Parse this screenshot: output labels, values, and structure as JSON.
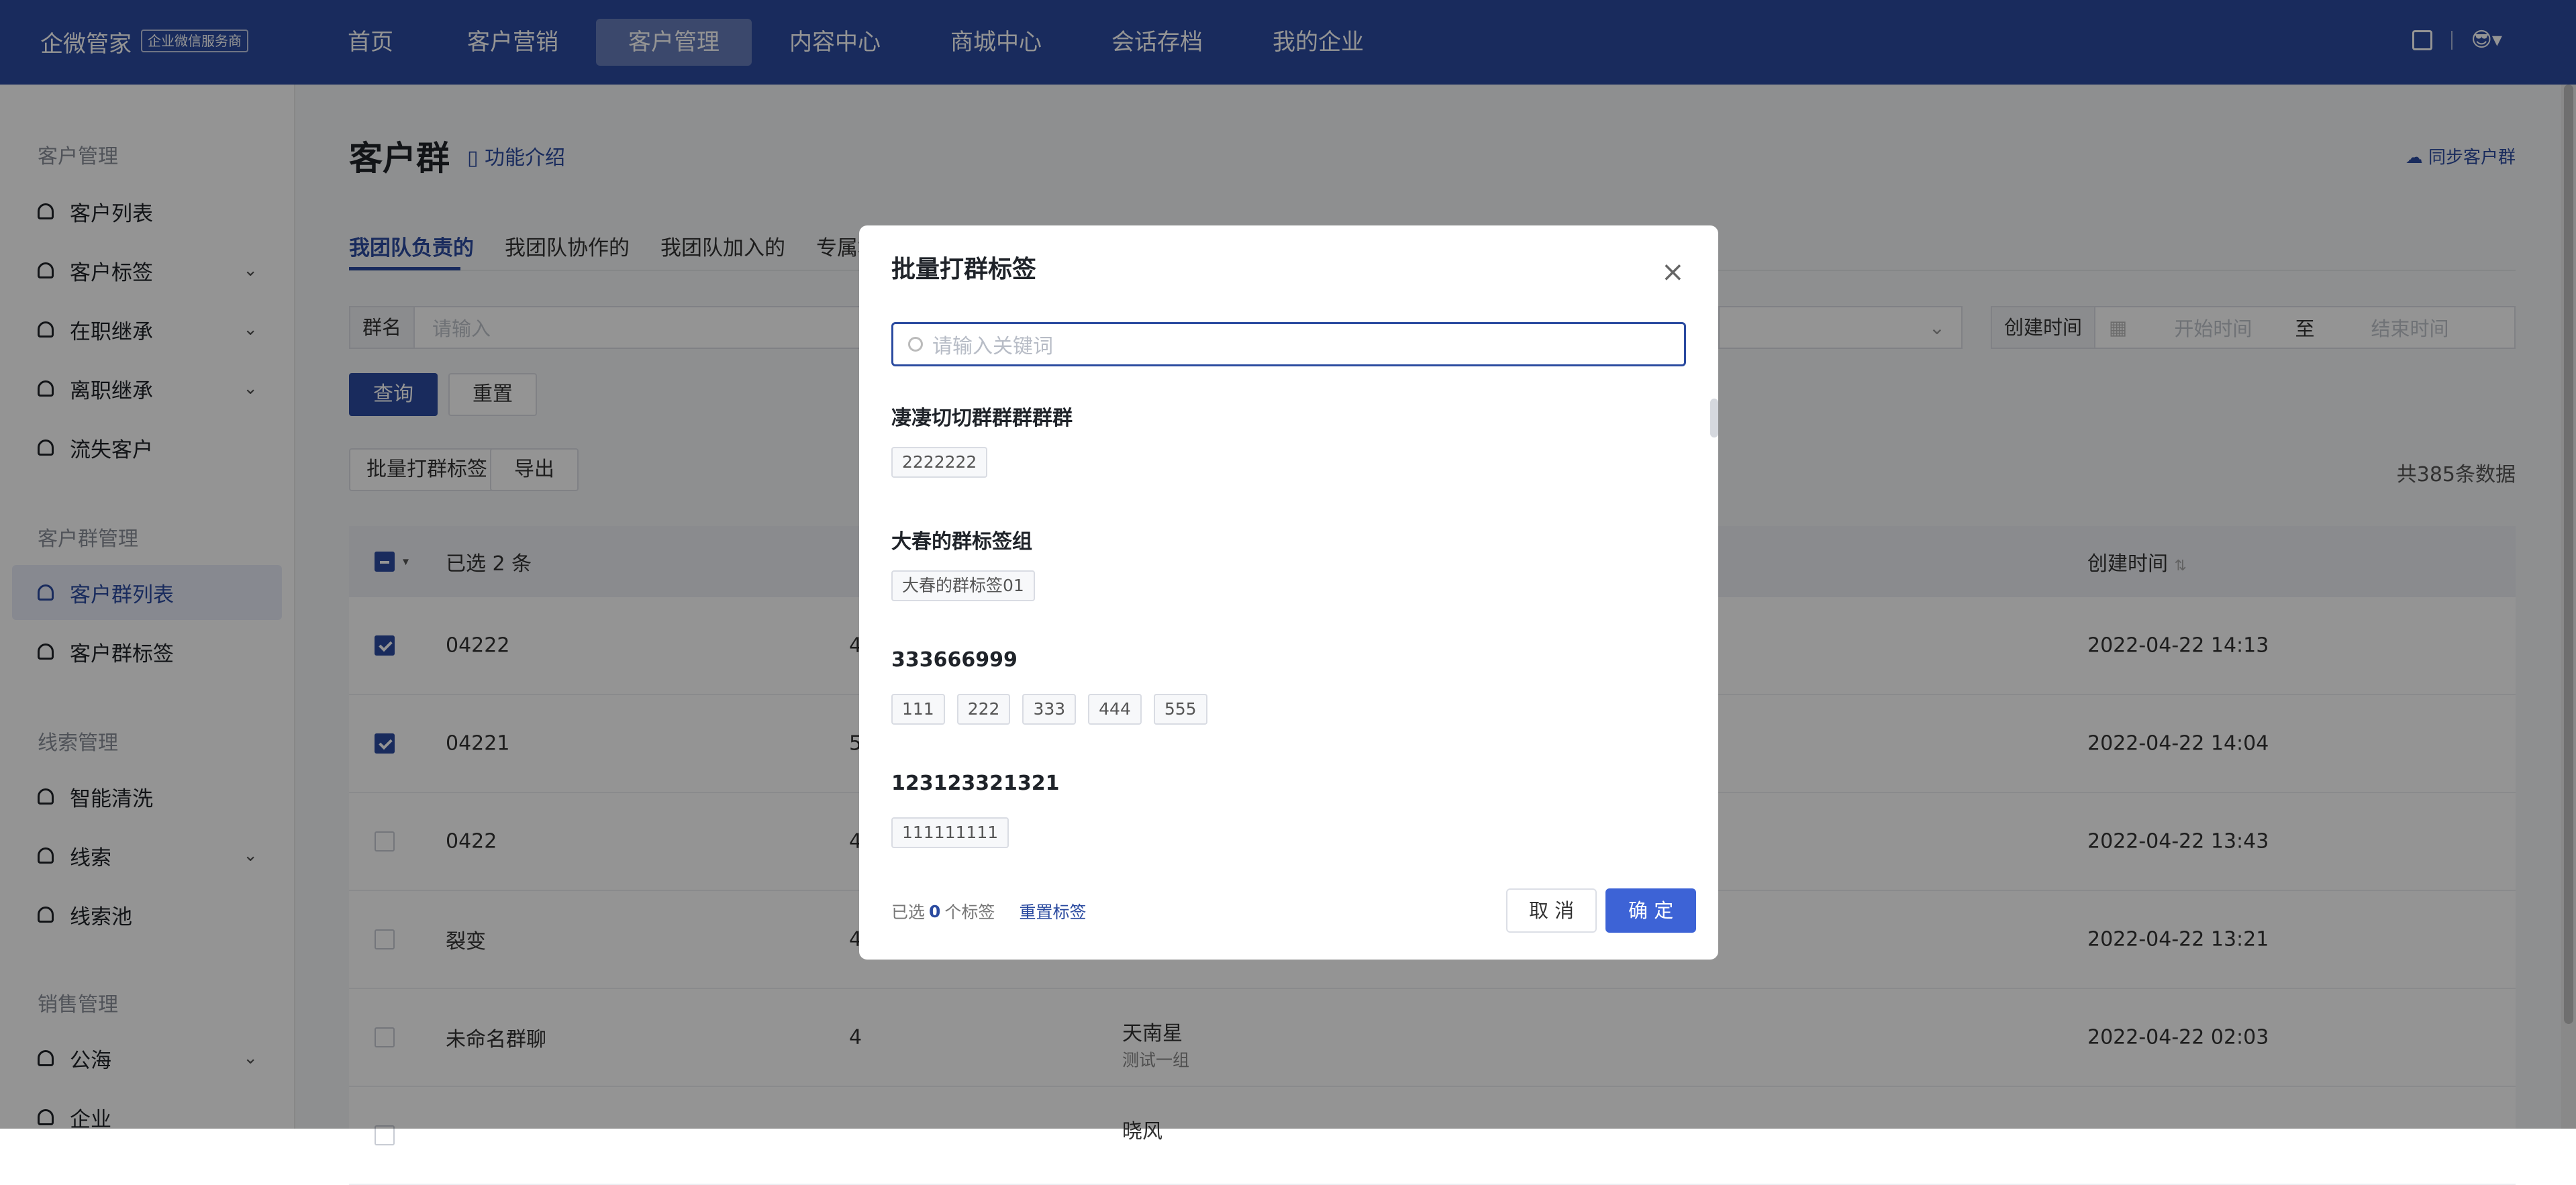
{
  "topbar": {
    "logo": "企微管家",
    "badge": "企业微信服务商",
    "nav": [
      "首页",
      "客户营销",
      "客户管理",
      "内容中心",
      "商城中心",
      "会话存档",
      "我的企业"
    ],
    "active_nav": "客户管理"
  },
  "sidebar": {
    "sections": [
      {
        "title": "客户管理",
        "items": [
          "客户列表",
          "客户标签",
          "在职继承",
          "离职继承",
          "流失客户"
        ]
      },
      {
        "title": "客户群管理",
        "items": [
          "客户群列表",
          "客户群标签"
        ]
      },
      {
        "title": "线索管理",
        "items": [
          "智能清洗",
          "线索",
          "线索池"
        ]
      },
      {
        "title": "销售管理",
        "items": [
          "公海",
          "企业"
        ]
      }
    ],
    "active_item": "客户群列表"
  },
  "page": {
    "title": "客户群",
    "intro_link": "功能介绍",
    "sync_link": "同步客户群",
    "tabs": [
      "我团队负责的",
      "我团队协作的",
      "我团队加入的",
      "专属群"
    ],
    "filters": {
      "group_name_label": "群名",
      "group_name_placeholder": "请输入",
      "created_label": "创建时间",
      "start_placeholder": "开始时间",
      "to": "至",
      "end_placeholder": "结束时间"
    },
    "query_button": "查询",
    "reset_button": "重置",
    "batch_tag_button": "批量打群标签",
    "export_button": "导出",
    "total": "共385条数据"
  },
  "table": {
    "selected_text": "已选 2 条",
    "created_header": "创建时间",
    "rows": [
      {
        "name": "04222",
        "count": "4",
        "owner": "",
        "team": "",
        "created": "2022-04-22 14:13",
        "checked": true
      },
      {
        "name": "04221",
        "count": "5",
        "owner": "",
        "team": "",
        "created": "2022-04-22 14:04",
        "checked": true
      },
      {
        "name": "0422",
        "count": "4",
        "owner": "",
        "team": "",
        "created": "2022-04-22 13:43",
        "checked": false
      },
      {
        "name": "裂变",
        "count": "4",
        "owner": "",
        "team": "",
        "created": "2022-04-22 13:21",
        "checked": false
      },
      {
        "name": "未命名群聊",
        "count": "4",
        "owner": "天南星",
        "team": "测试一组",
        "created": "2022-04-22 02:03",
        "checked": false
      },
      {
        "name": "",
        "count": "",
        "owner": "晓风",
        "team": "",
        "created": "",
        "checked": false
      }
    ]
  },
  "modal": {
    "title": "批量打群标签",
    "search_placeholder": "请输入关键词",
    "groups": [
      {
        "title": "凄凄切切群群群群群",
        "tags": [
          "2222222"
        ]
      },
      {
        "title": "大春的群标签组",
        "tags": [
          "大春的群标签01"
        ]
      },
      {
        "title": "333666999",
        "tags": [
          "111",
          "222",
          "333",
          "444",
          "555"
        ]
      },
      {
        "title": "123123321321",
        "tags": [
          "111111111"
        ]
      }
    ],
    "footer_prefix": "已选",
    "selected_count": "0",
    "footer_suffix": "个标签",
    "reset_tags": "重置标签",
    "cancel": "取 消",
    "confirm": "确 定"
  }
}
